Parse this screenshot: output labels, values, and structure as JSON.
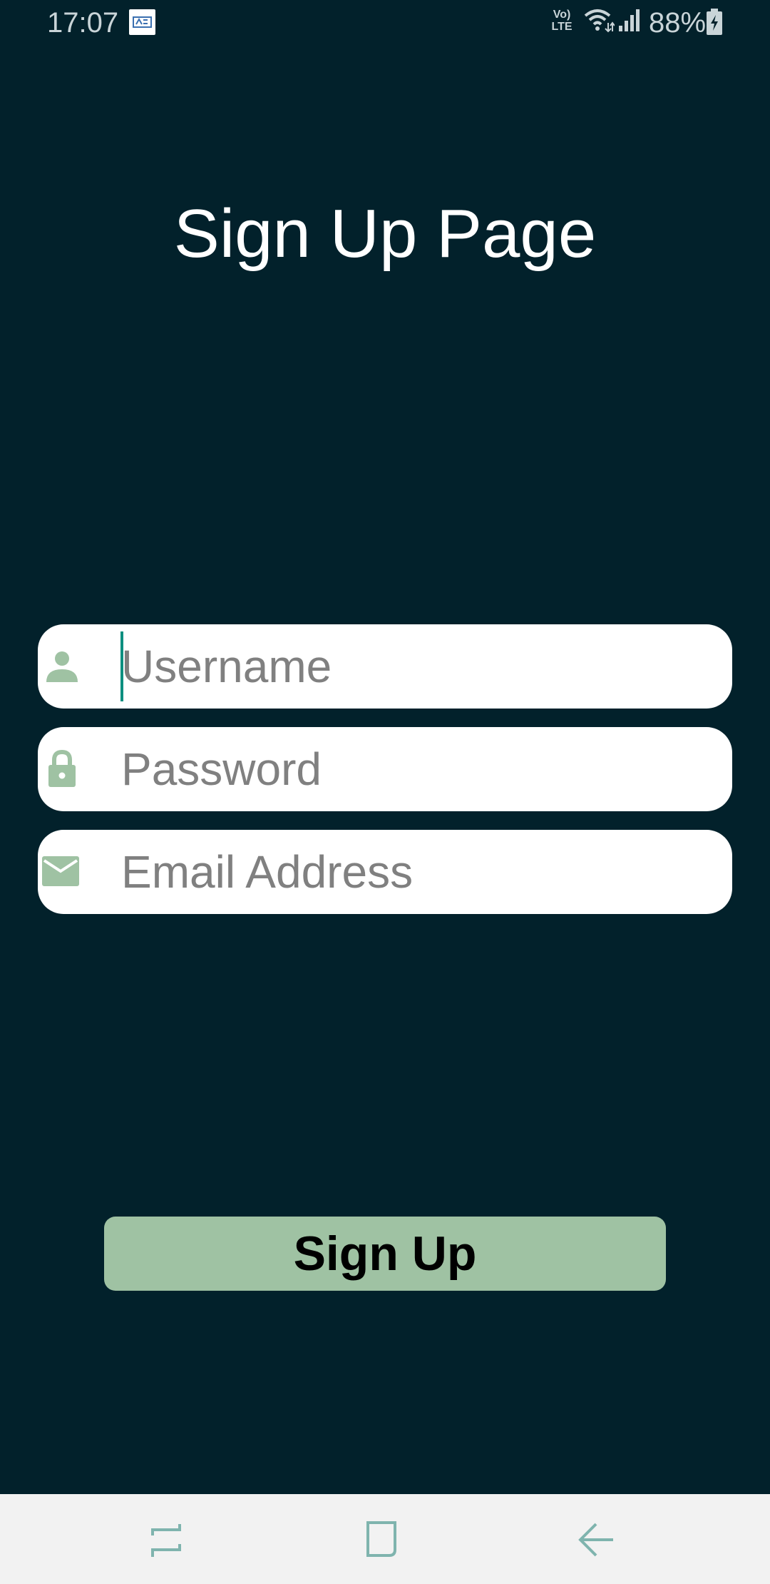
{
  "status_bar": {
    "time": "17:07",
    "volte": "Vo)\nLTE",
    "battery_percent": "88%",
    "icons": [
      "notification-icon",
      "volte-icon",
      "wifi-icon",
      "signal-icon",
      "battery-charging-icon"
    ]
  },
  "page": {
    "title": "Sign Up Page"
  },
  "form": {
    "username": {
      "value": "",
      "placeholder": "Username",
      "icon": "person-icon"
    },
    "password": {
      "value": "",
      "placeholder": "Password",
      "icon": "lock-icon"
    },
    "email": {
      "value": "",
      "placeholder": "Email Address",
      "icon": "envelope-icon"
    },
    "signup_label": "Sign Up"
  },
  "nav_bar": {
    "icons": [
      "recents-icon",
      "home-icon",
      "back-icon"
    ]
  },
  "colors": {
    "background": "#02212b",
    "field_background": "#ffffff",
    "icon_accent": "#9fc2a3",
    "button_background": "#9fc2a3",
    "caret": "#0d8f80",
    "placeholder": "#808080",
    "nav_bar": "#f2f2f2"
  }
}
